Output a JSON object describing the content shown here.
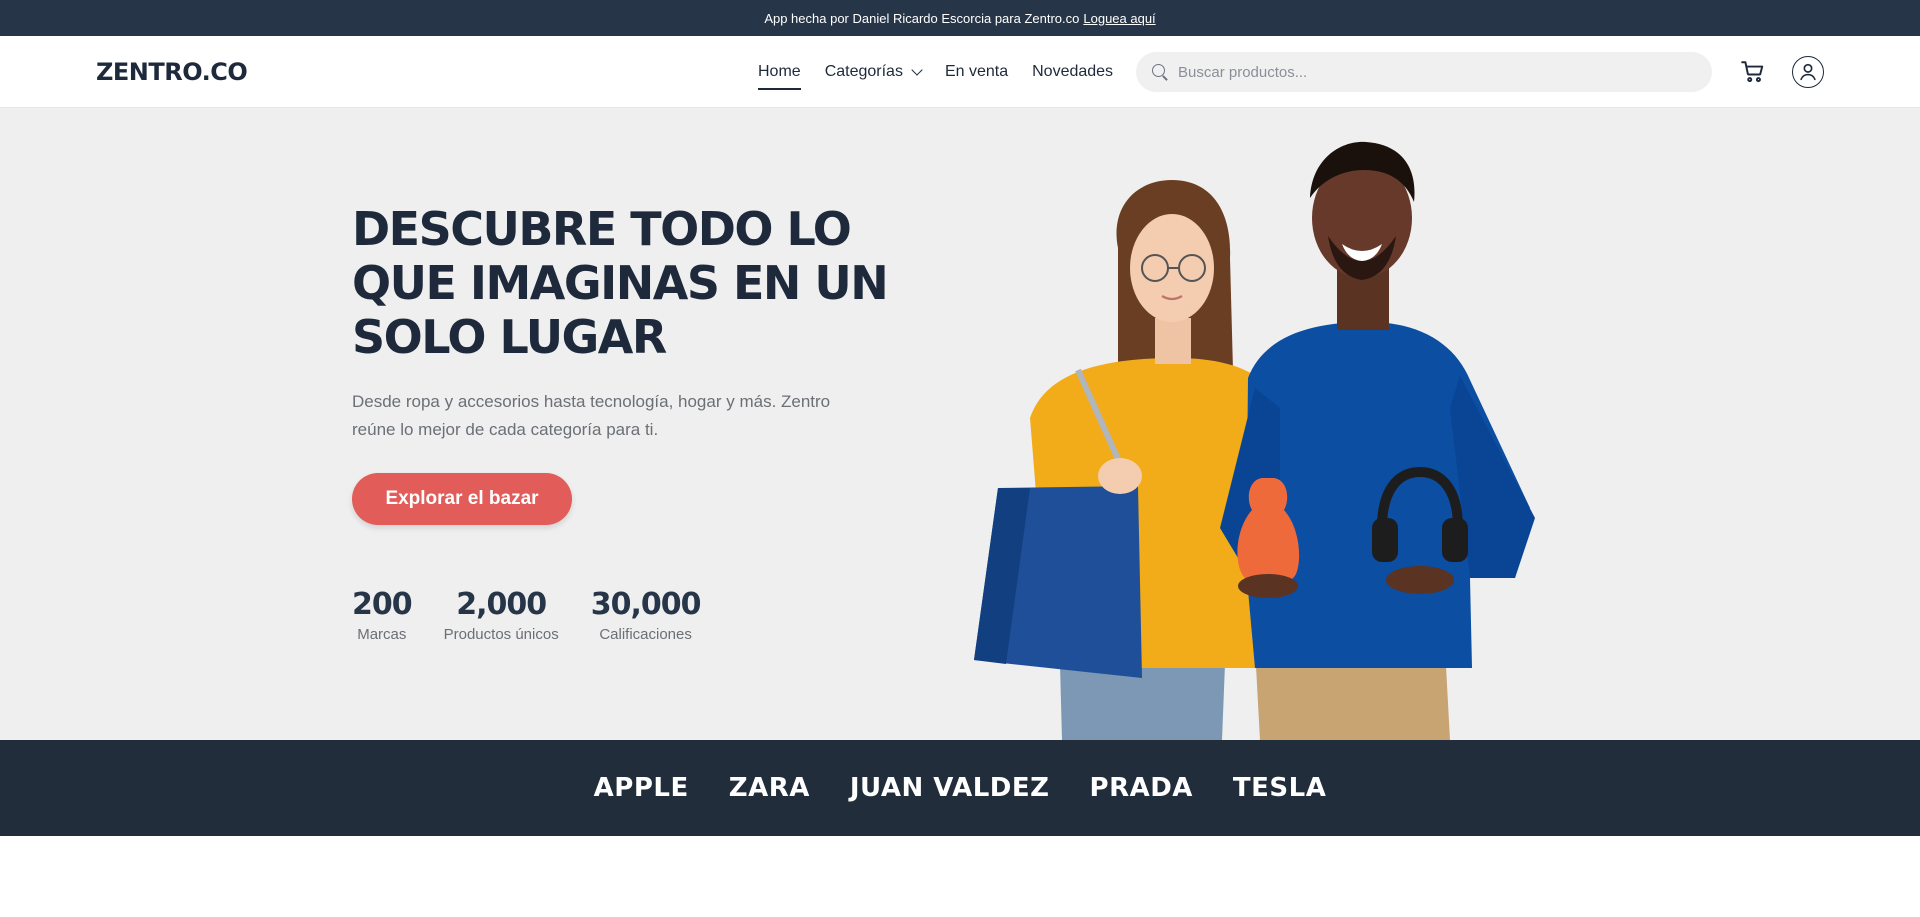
{
  "topbar": {
    "text": "App hecha por Daniel Ricardo Escorcia para Zentro.co",
    "login_link": "Loguea aquí"
  },
  "nav": {
    "logo": "ZENTRO.CO",
    "links": [
      {
        "label": "Home",
        "active": true
      },
      {
        "label": "Categorías",
        "dropdown": true
      },
      {
        "label": "En venta"
      },
      {
        "label": "Novedades"
      }
    ],
    "search_placeholder": "Buscar productos...",
    "icons": [
      "search-icon",
      "cart-icon",
      "user-icon"
    ]
  },
  "hero": {
    "title_lines": [
      "DESCUBRE TODO LO",
      "QUE IMAGINAS EN UN",
      "SOLO LUGAR"
    ],
    "description_lines": [
      "Desde ropa y accesorios hasta tecnología, hogar y más. Zentro",
      "reúne lo mejor de cada categoría para ti."
    ],
    "cta_label": "Explorar el bazar",
    "stats": [
      {
        "value": "200",
        "label": "Marcas"
      },
      {
        "value": "2,000",
        "label": "Productos únicos"
      },
      {
        "value": "30,000",
        "label": "Calificaciones"
      }
    ]
  },
  "brands": [
    "APPLE",
    "ZARA",
    "JUAN VALDEZ",
    "PRADA",
    "TESLA"
  ],
  "colors": {
    "topbar_bg": "#273548",
    "primary_text": "#1e2a3b",
    "hero_bg": "#efefef",
    "cta": "#e25c5a",
    "brands_bg": "#222d3c"
  }
}
